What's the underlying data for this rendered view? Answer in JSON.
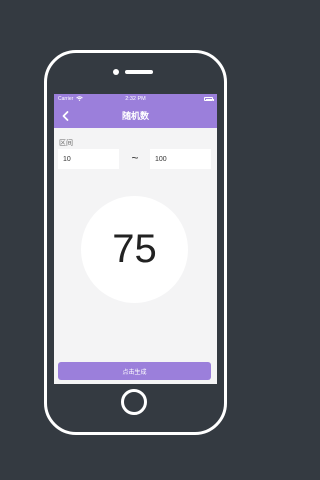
{
  "status_bar": {
    "carrier": "Carrier",
    "time": "2:32 PM",
    "wifi_icon": "wifi-icon",
    "battery_icon": "battery-icon"
  },
  "nav": {
    "back_icon": "chevron-left-icon",
    "title": "随机数"
  },
  "range": {
    "label": "区间",
    "min_value": "10",
    "separator": "~",
    "max_value": "100"
  },
  "result": {
    "value": "75"
  },
  "actions": {
    "generate_label": "点击生成"
  },
  "colors": {
    "accent": "#9b7fdb",
    "background": "#343a41",
    "screen": "#f4f4f5"
  }
}
